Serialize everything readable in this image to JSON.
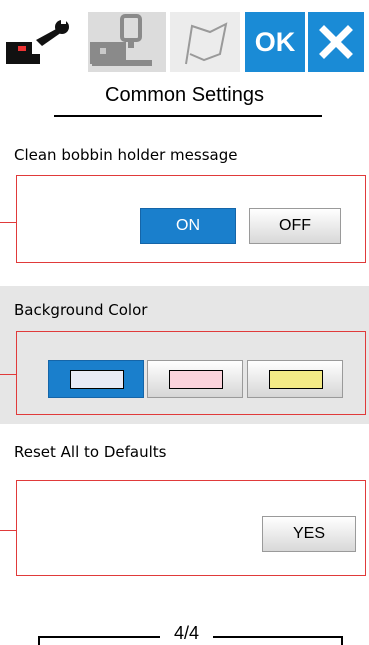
{
  "toolbar": {
    "tabs": [
      {
        "icon": "wrench-machine-icon",
        "active": true
      },
      {
        "icon": "machine-hoop-icon",
        "active": false
      },
      {
        "icon": "flag-icon",
        "active": false
      }
    ],
    "ok_label": "OK",
    "close_icon": "close-icon",
    "accent_color": "#1a8bd6"
  },
  "page": {
    "title": "Common Settings",
    "indicator": "4/4"
  },
  "sections": {
    "bobbin": {
      "label": "Clean bobbin holder message",
      "on_label": "ON",
      "off_label": "OFF",
      "selected": "ON"
    },
    "background": {
      "label": "Background Color",
      "options": [
        {
          "color": "#e8eaf6",
          "selected": true
        },
        {
          "color": "#fbd3dc",
          "selected": false
        },
        {
          "color": "#f3ea86",
          "selected": false
        }
      ]
    },
    "reset": {
      "label": "Reset All to Defaults",
      "yes_label": "YES"
    }
  },
  "colors": {
    "highlight_border": "#e03a3a",
    "band_background": "#e6e6e6",
    "button_active": "#1a7fcc"
  }
}
